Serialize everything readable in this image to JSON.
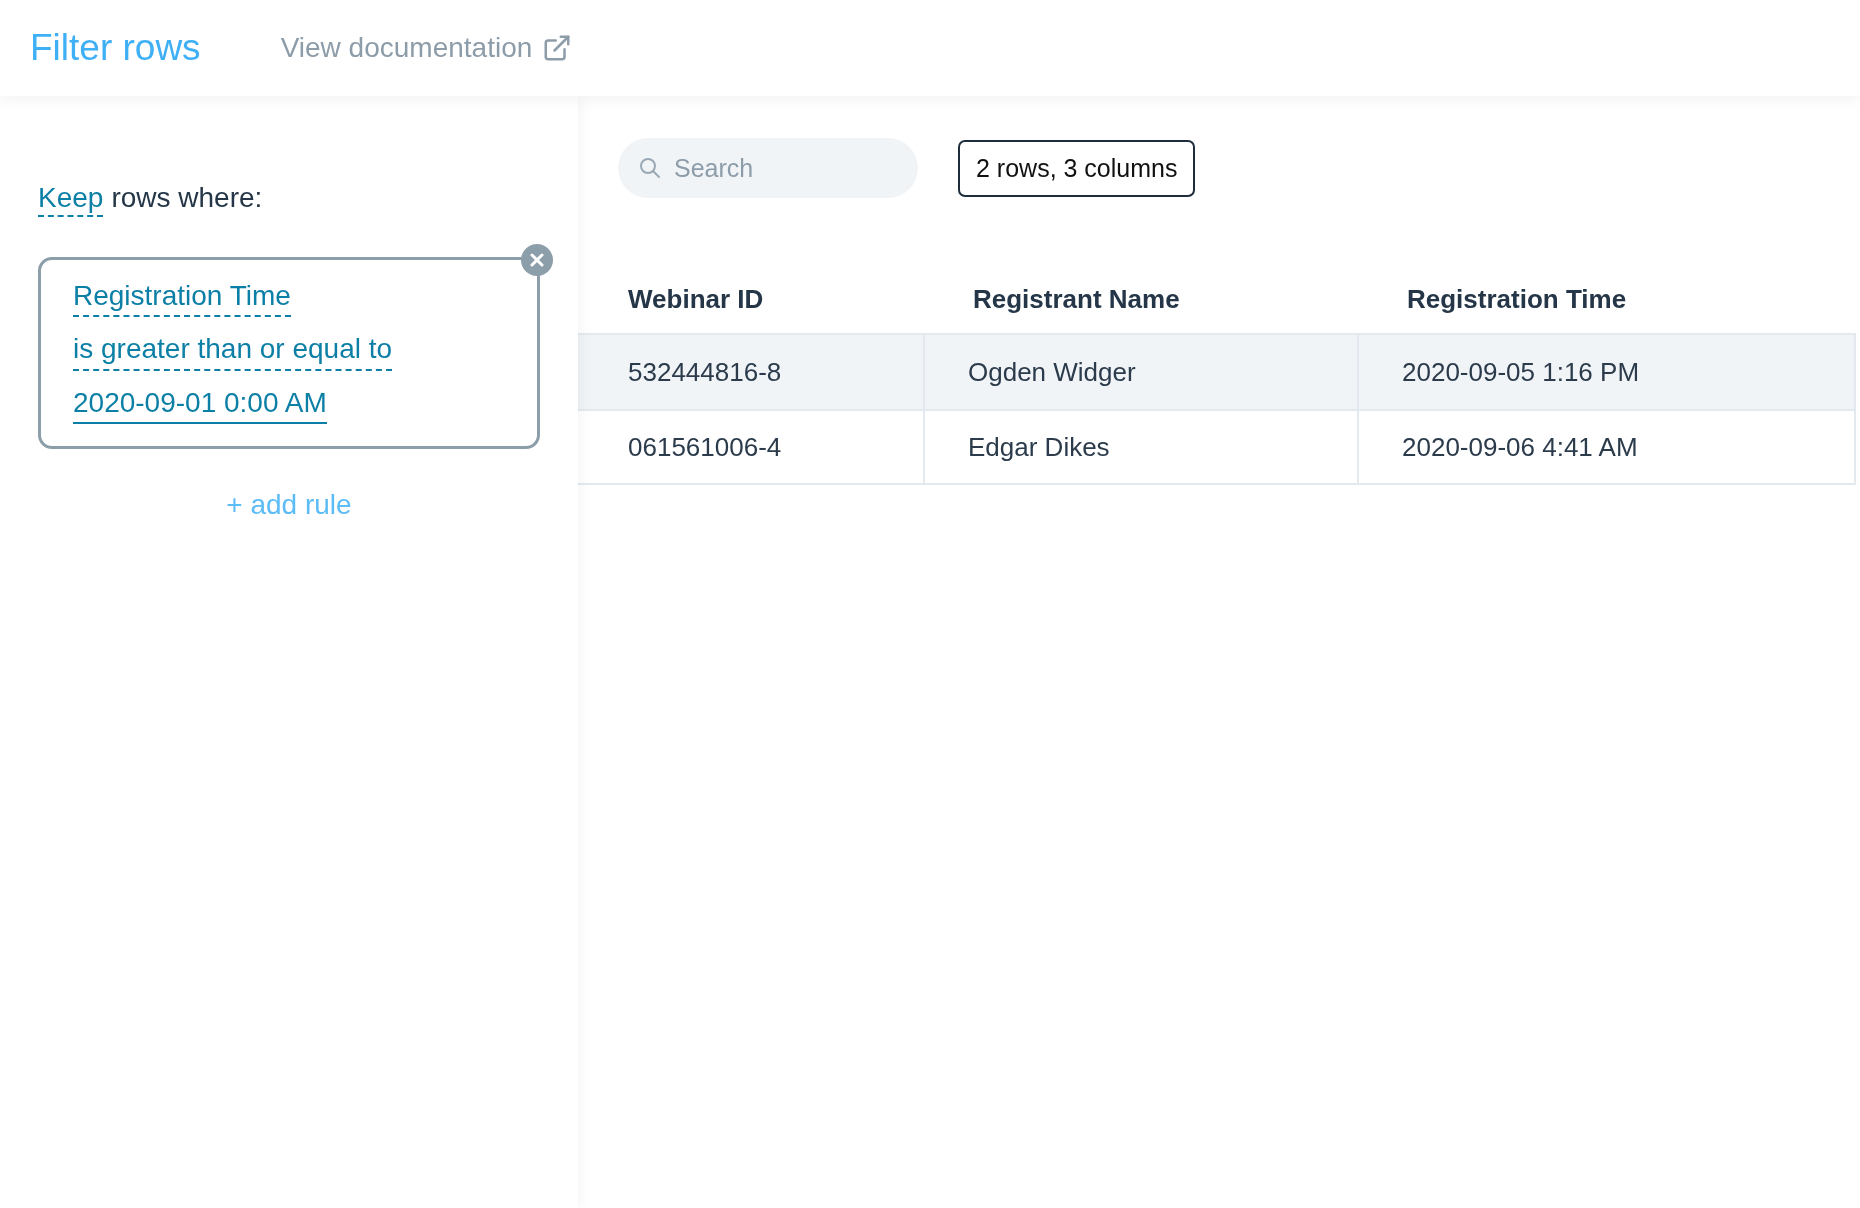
{
  "header": {
    "title": "Filter rows",
    "doc_link": "View documentation"
  },
  "filter": {
    "mode": "Keep",
    "label": "rows where:",
    "rules": [
      {
        "column": "Registration Time",
        "operator": "is greater than or equal to",
        "value": "2020-09-01 0:00 AM"
      }
    ],
    "add_rule": "+ add rule"
  },
  "toolbar": {
    "search": {
      "placeholder": "Search"
    },
    "summary": "2 rows, 3 columns"
  },
  "table": {
    "columns": [
      "Webinar ID",
      "Registrant Name",
      "Registration Time"
    ],
    "rows": [
      {
        "highlighted": true,
        "cells": [
          "532444816-8",
          "Ogden Widger",
          "2020-09-05 1:16 PM"
        ]
      },
      {
        "highlighted": false,
        "cells": [
          "061561006-4",
          "Edgar Dikes",
          "2020-09-06 4:41 AM"
        ]
      }
    ]
  }
}
